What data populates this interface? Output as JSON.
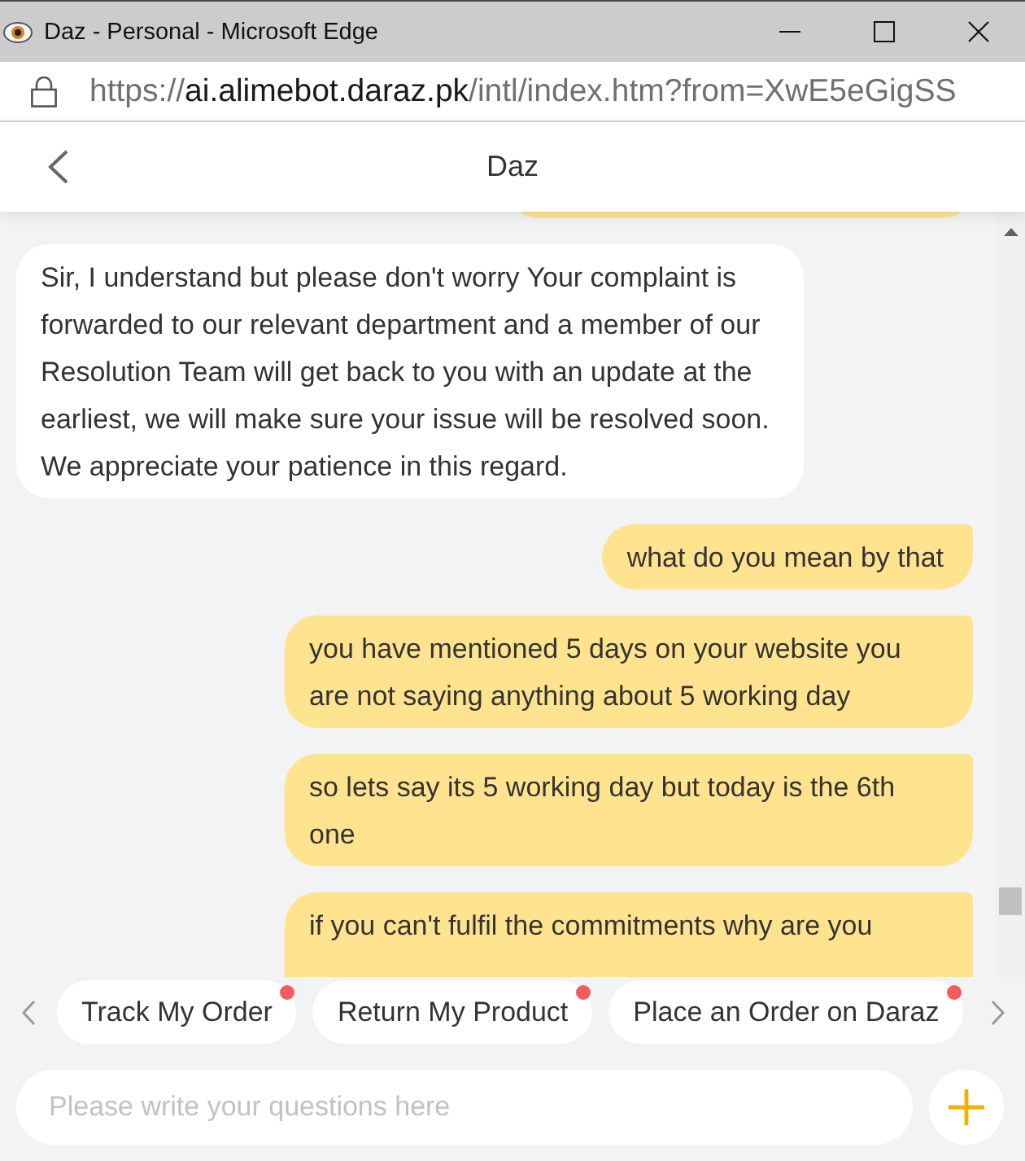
{
  "window": {
    "title": "Daz - Personal - Microsoft Edge"
  },
  "address_bar": {
    "scheme": "https://",
    "host": "ai.alimebot.daraz.pk",
    "path": "/intl/index.htm?from=XwE5eGigSS"
  },
  "header": {
    "title": "Daz"
  },
  "messages": [
    {
      "kind": "user",
      "clipped_top": true,
      "clipped_bottom": false
    },
    {
      "kind": "bot",
      "clipped_top": false,
      "clipped_bottom": false,
      "text": "Sir, I understand but please don't worry Your complaint is forwarded to our relevant department and a member of our Resolution Team will get back to you with an update at the earliest, we will make sure your issue will be resolved soon. We appreciate your patience in this regard."
    },
    {
      "kind": "user",
      "clipped_top": false,
      "clipped_bottom": false,
      "text": "what do you mean by that"
    },
    {
      "kind": "user",
      "clipped_top": false,
      "clipped_bottom": false,
      "text": "you have mentioned 5 days on your website you are not saying anything about 5 working day"
    },
    {
      "kind": "user",
      "clipped_top": false,
      "clipped_bottom": false,
      "text": "so lets say its 5 working day but today is the 6th one"
    },
    {
      "kind": "user",
      "clipped_top": false,
      "clipped_bottom": true,
      "text": "if you can't fulfil the commitments why are you"
    }
  ],
  "quick_replies": [
    {
      "label": "Track My Order",
      "dot": true
    },
    {
      "label": "Return My Product",
      "dot": true
    },
    {
      "label": "Place an Order on Daraz",
      "dot": true
    }
  ],
  "input": {
    "placeholder": "Please write your questions here"
  }
}
